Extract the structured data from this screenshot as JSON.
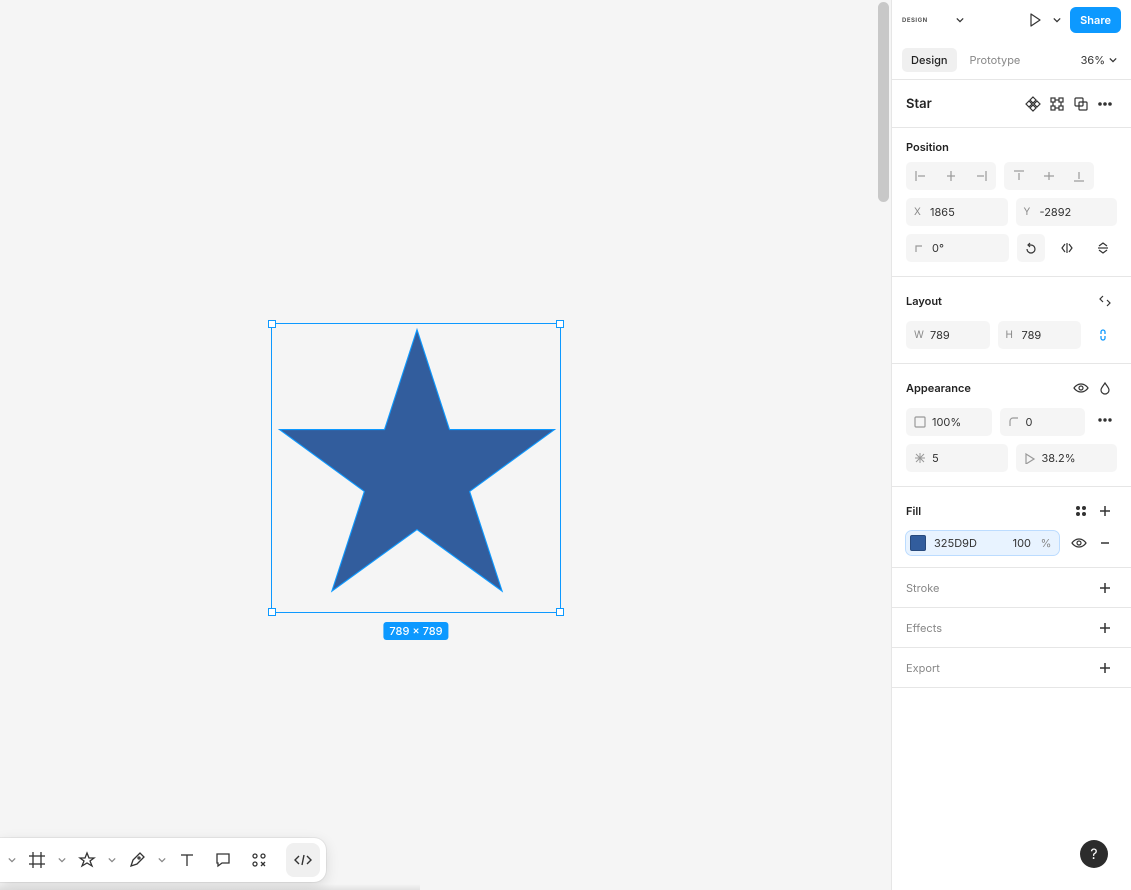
{
  "header": {
    "brand": "DESIGN",
    "share": "Share",
    "zoom": "36%"
  },
  "tabs": {
    "design": "Design",
    "prototype": "Prototype"
  },
  "object": {
    "name": "Star"
  },
  "position": {
    "label": "Position",
    "x": "1865",
    "y": "-2892",
    "rotation": "0°"
  },
  "layout": {
    "label": "Layout",
    "w": "789",
    "h": "789"
  },
  "appearance": {
    "label": "Appearance",
    "opacity": "100%",
    "radius": "0",
    "points": "5",
    "ratio": "38.2%"
  },
  "fill": {
    "label": "Fill",
    "hex": "325D9D",
    "opacity": "100",
    "unit": "%"
  },
  "stroke": {
    "label": "Stroke"
  },
  "effects": {
    "label": "Effects"
  },
  "export": {
    "label": "Export"
  },
  "canvas": {
    "dimension_badge": "789 × 789"
  }
}
